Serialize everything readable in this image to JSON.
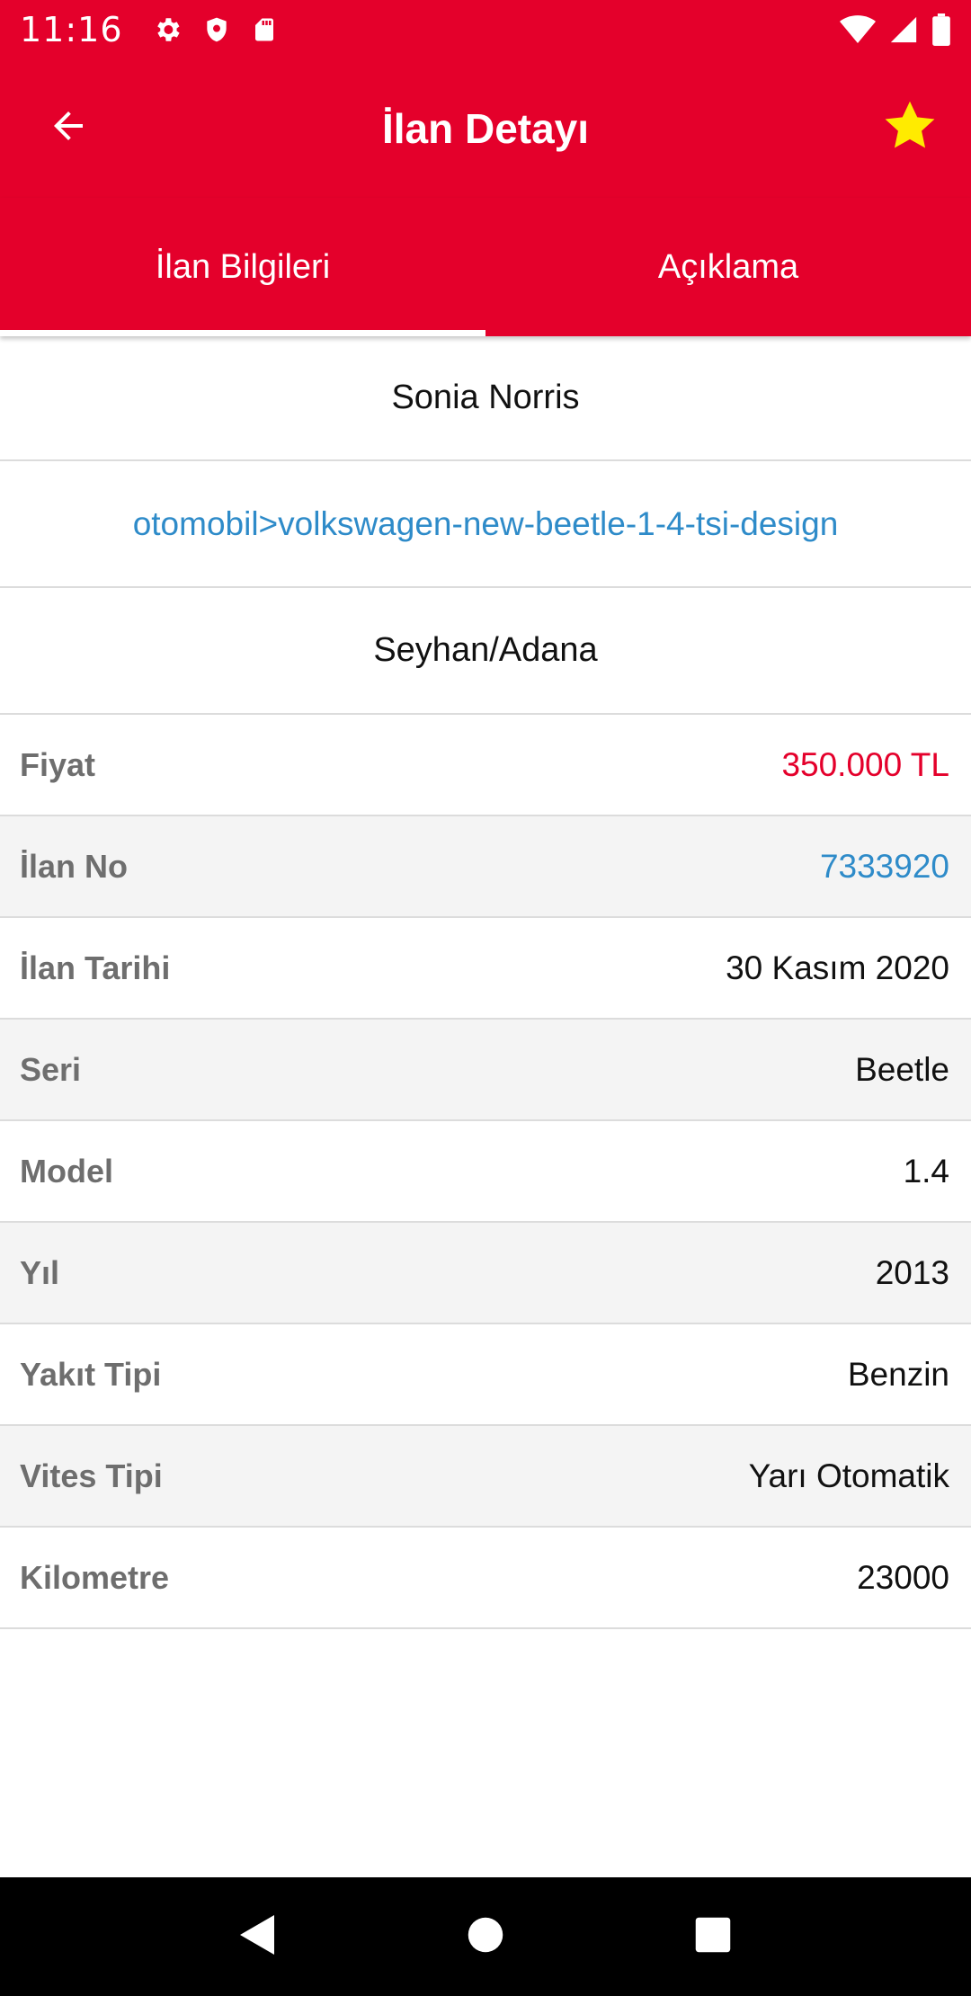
{
  "status_bar": {
    "time": "11:16",
    "left_icons": [
      "settings-icon",
      "shield-icon",
      "sd-card-icon"
    ],
    "right_icons": [
      "wifi-icon",
      "signal-icon",
      "battery-icon"
    ]
  },
  "app_bar": {
    "title": "İlan Detayı",
    "back_icon": "arrow-left-icon",
    "favorite_icon": "star-icon",
    "favorite_color": "#ffeb00"
  },
  "tabs": [
    {
      "label": "İlan Bilgileri",
      "active": true
    },
    {
      "label": "Açıklama",
      "active": false
    }
  ],
  "listing": {
    "seller": "Sonia Norris",
    "category_path": "otomobil>volkswagen-new-beetle-1-4-tsi-design",
    "location": "Seyhan/Adana"
  },
  "details": [
    {
      "label": "Fiyat",
      "value": "350.000 TL"
    },
    {
      "label": "İlan No",
      "value": "7333920"
    },
    {
      "label": "İlan Tarihi",
      "value": "30 Kasım 2020"
    },
    {
      "label": "Seri",
      "value": "Beetle"
    },
    {
      "label": "Model",
      "value": "1.4"
    },
    {
      "label": "Yıl",
      "value": "2013"
    },
    {
      "label": "Yakıt Tipi",
      "value": "Benzin"
    },
    {
      "label": "Vites Tipi",
      "value": "Yarı Otomatik"
    },
    {
      "label": "Kilometre",
      "value": "23000"
    }
  ],
  "nav_bar": {
    "icons": [
      "back-triangle-icon",
      "home-circle-icon",
      "recents-square-icon"
    ]
  },
  "colors": {
    "brand": "#e4002b",
    "link": "#2e8bc9",
    "label": "#6e6e6e"
  }
}
